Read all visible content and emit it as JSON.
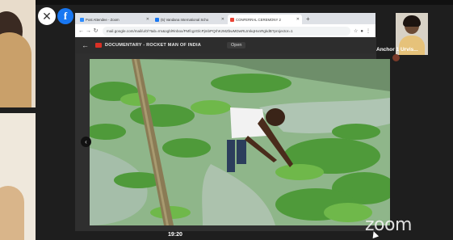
{
  "gallery": {
    "right_tile_name": "Anchor 1 Urvis..."
  },
  "controls": {
    "close_icon": "close-icon",
    "facebook_label": "f"
  },
  "browser": {
    "tabs": [
      {
        "label": "Post Attendee - Zoom",
        "icon_color": "#2d8cff"
      },
      {
        "label": "(5) Vandana International Scho",
        "icon_color": "#1877f2"
      },
      {
        "label": "CONFERRAL CEREMONY 2",
        "icon_color": "#ea4335"
      }
    ],
    "new_tab": "+",
    "url": "mail.google.com/mail/u/0/?tab=rm&ogbl#inbox/FMfcgzGlcPjmbPQrhKzMZbwMDwRLtmkqHxnRgkdB?projector=1"
  },
  "viewer": {
    "document_title": "DOCUMENTARY - ROCKET MAN OF INDIA",
    "open_label": "Open"
  },
  "meeting": {
    "time": "19:20",
    "logo": "zoom"
  }
}
